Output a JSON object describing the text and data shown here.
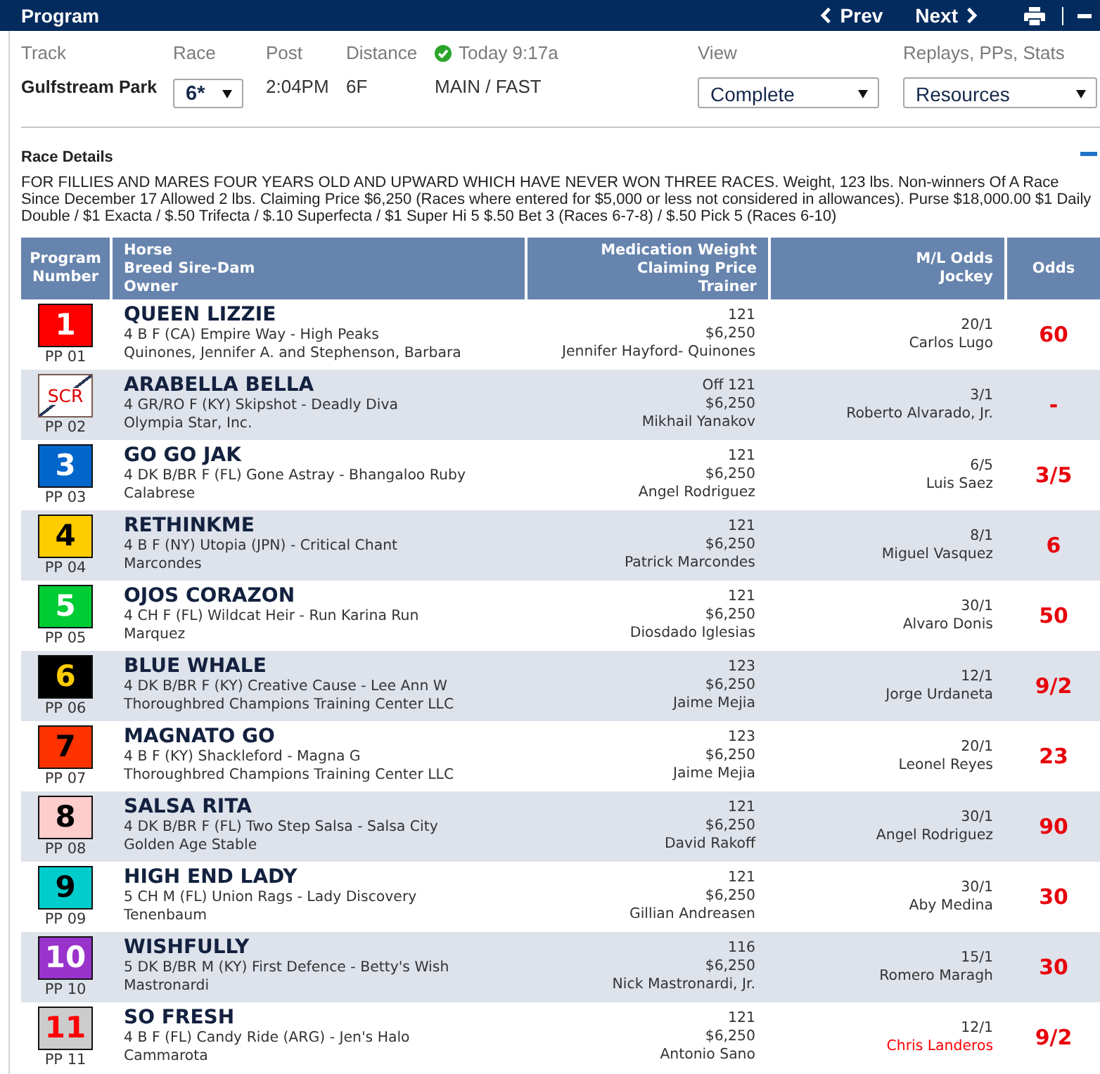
{
  "title_bar": {
    "title": "Program",
    "prev": "Prev",
    "next": "Next"
  },
  "race_info": {
    "fields": [
      {
        "kind": "strong",
        "label": "Track",
        "value": "Gulfstream Park"
      },
      {
        "kind": "select",
        "label": "Race",
        "value": "6*"
      },
      {
        "kind": "text",
        "label": "Post",
        "value": "2:04PM"
      },
      {
        "kind": "text",
        "label": "Distance",
        "value": "6F"
      },
      {
        "kind": "status",
        "label": "Today 9:17a",
        "value": "MAIN / FAST"
      }
    ],
    "options": [
      {
        "label": "View",
        "value": "Complete"
      },
      {
        "label": "Replays, PPs, Stats",
        "value": "Resources"
      }
    ]
  },
  "race_details": {
    "title": "Race Details",
    "text": "FOR FILLIES AND MARES FOUR YEARS OLD AND UPWARD WHICH HAVE NEVER WON THREE RACES. Weight, 123 lbs. Non-winners Of A Race Since December 17 Allowed 2 lbs. Claiming Price $6,250 (Races where entered for $5,000 or less not considered in allowances). Purse $18,000.00 $1 Daily Double / $1 Exacta / $.50 Trifecta / $.10 Superfecta / $1 Super Hi 5 $.50 Bet 3 (Races 6-7-8) / $.50 Pick 5 (Races 6-10)"
  },
  "table": {
    "columns": [
      {
        "labels": [
          "Program Number"
        ]
      },
      {
        "labels": [
          "Horse",
          "Breed Sire-Dam",
          "Owner"
        ]
      },
      {
        "labels": [
          "Medication Weight",
          "Claiming Price",
          "Trainer"
        ]
      },
      {
        "labels": [
          "M/L Odds",
          "Jockey"
        ]
      },
      {
        "labels": [
          "Odds"
        ]
      }
    ],
    "rows": [
      {
        "number": {
          "text": "1",
          "color": "#ffffff"
        },
        "color": "#ff0000",
        "scratched": false,
        "post_position": "PP 01",
        "horse": "QUEEN LIZZIE",
        "breeding": "4 B F (CA) Empire Way - High Peaks",
        "owner": "Quinones, Jennifer A. and Stephenson, Barbara",
        "medication_weight": "121",
        "claiming_price": "$6,250",
        "trainer": "Jennifer Hayford- Quinones",
        "ml_odds": "20/1",
        "jockey": "Carlos Lugo",
        "jockey_changed": false,
        "odds": "60"
      },
      {
        "number": {
          "text": "SCR",
          "color": "#e00000"
        },
        "color": "#ffffff",
        "scratched": true,
        "post_position": "PP 02",
        "horse": "ARABELLA BELLA",
        "breeding": "4 GR/RO F (KY) Skipshot - Deadly Diva",
        "owner": "Olympia Star, Inc.",
        "medication_weight": "Off 121",
        "claiming_price": "$6,250",
        "trainer": "Mikhail Yanakov",
        "ml_odds": "3/1",
        "jockey": "Roberto Alvarado, Jr.",
        "jockey_changed": false,
        "odds": "-"
      },
      {
        "number": {
          "text": "3",
          "color": "#ffffff"
        },
        "color": "#0066cc",
        "scratched": false,
        "post_position": "PP 03",
        "horse": "GO GO JAK",
        "breeding": "4 DK B/BR F (FL) Gone Astray - Bhangaloo Ruby",
        "owner": "Calabrese",
        "medication_weight": "121",
        "claiming_price": "$6,250",
        "trainer": "Angel Rodriguez",
        "ml_odds": "6/5",
        "jockey": "Luis Saez",
        "jockey_changed": false,
        "odds": "3/5"
      },
      {
        "number": {
          "text": "4",
          "color": "#000000"
        },
        "color": "#ffcc00",
        "scratched": false,
        "post_position": "PP 04",
        "horse": "RETHINKME",
        "breeding": "4 B F (NY) Utopia (JPN) - Critical Chant",
        "owner": "Marcondes",
        "medication_weight": "121",
        "claiming_price": "$6,250",
        "trainer": "Patrick Marcondes",
        "ml_odds": "8/1",
        "jockey": "Miguel Vasquez",
        "jockey_changed": false,
        "odds": "6"
      },
      {
        "number": {
          "text": "5",
          "color": "#ffffff"
        },
        "color": "#00cc33",
        "scratched": false,
        "post_position": "PP 05",
        "horse": "OJOS CORAZON",
        "breeding": "4 CH F (FL) Wildcat Heir - Run Karina Run",
        "owner": "Marquez",
        "medication_weight": "121",
        "claiming_price": "$6,250",
        "trainer": "Diosdado Iglesias",
        "ml_odds": "30/1",
        "jockey": "Alvaro Donis",
        "jockey_changed": false,
        "odds": "50"
      },
      {
        "number": {
          "text": "6",
          "color": "#ffcc00"
        },
        "color": "#000000",
        "scratched": false,
        "post_position": "PP 06",
        "horse": "BLUE WHALE",
        "breeding": "4 DK B/BR F (KY) Creative Cause - Lee Ann W",
        "owner": "Thoroughbred Champions Training Center LLC",
        "medication_weight": "123",
        "claiming_price": "$6,250",
        "trainer": "Jaime Mejia",
        "ml_odds": "12/1",
        "jockey": "Jorge Urdaneta",
        "jockey_changed": false,
        "odds": "9/2"
      },
      {
        "number": {
          "text": "7",
          "color": "#000000"
        },
        "color": "#ff3300",
        "scratched": false,
        "post_position": "PP 07",
        "horse": "MAGNATO GO",
        "breeding": "4 B F (KY) Shackleford - Magna G",
        "owner": "Thoroughbred Champions Training Center LLC",
        "medication_weight": "123",
        "claiming_price": "$6,250",
        "trainer": "Jaime Mejia",
        "ml_odds": "20/1",
        "jockey": "Leonel Reyes",
        "jockey_changed": false,
        "odds": "23"
      },
      {
        "number": {
          "text": "8",
          "color": "#000000"
        },
        "color": "#ffcccc",
        "scratched": false,
        "post_position": "PP 08",
        "horse": "SALSA RITA",
        "breeding": "4 DK B/BR F (FL) Two Step Salsa - Salsa City",
        "owner": "Golden Age Stable",
        "medication_weight": "121",
        "claiming_price": "$6,250",
        "trainer": "David Rakoff",
        "ml_odds": "30/1",
        "jockey": "Angel Rodriguez",
        "jockey_changed": false,
        "odds": "90"
      },
      {
        "number": {
          "text": "9",
          "color": "#000000"
        },
        "color": "#00cccc",
        "scratched": false,
        "post_position": "PP 09",
        "horse": "HIGH END LADY",
        "breeding": "5 CH M (FL) Union Rags - Lady Discovery",
        "owner": "Tenenbaum",
        "medication_weight": "121",
        "claiming_price": "$6,250",
        "trainer": "Gillian Andreasen",
        "ml_odds": "30/1",
        "jockey": "Aby Medina",
        "jockey_changed": false,
        "odds": "30"
      },
      {
        "number": {
          "text": "10",
          "color": "#ffffff"
        },
        "color": "#9933cc",
        "scratched": false,
        "post_position": "PP 10",
        "horse": "WISHFULLY",
        "breeding": "5 DK B/BR M (KY) First Defence - Betty's Wish",
        "owner": "Mastronardi",
        "medication_weight": "116",
        "claiming_price": "$6,250",
        "trainer": "Nick Mastronardi, Jr.",
        "ml_odds": "15/1",
        "jockey": "Romero Maragh",
        "jockey_changed": false,
        "odds": "30"
      },
      {
        "number": {
          "text": "11",
          "color": "#ff0000"
        },
        "color": "#cccccc",
        "scratched": false,
        "post_position": "PP 11",
        "horse": "SO FRESH",
        "breeding": "4 B F (FL) Candy Ride (ARG) - Jen's Halo",
        "owner": "Cammarota",
        "medication_weight": "121",
        "claiming_price": "$6,250",
        "trainer": "Antonio Sano",
        "ml_odds": "12/1",
        "jockey": "Chris Landeros",
        "jockey_changed": true,
        "odds": "9/2"
      }
    ]
  }
}
